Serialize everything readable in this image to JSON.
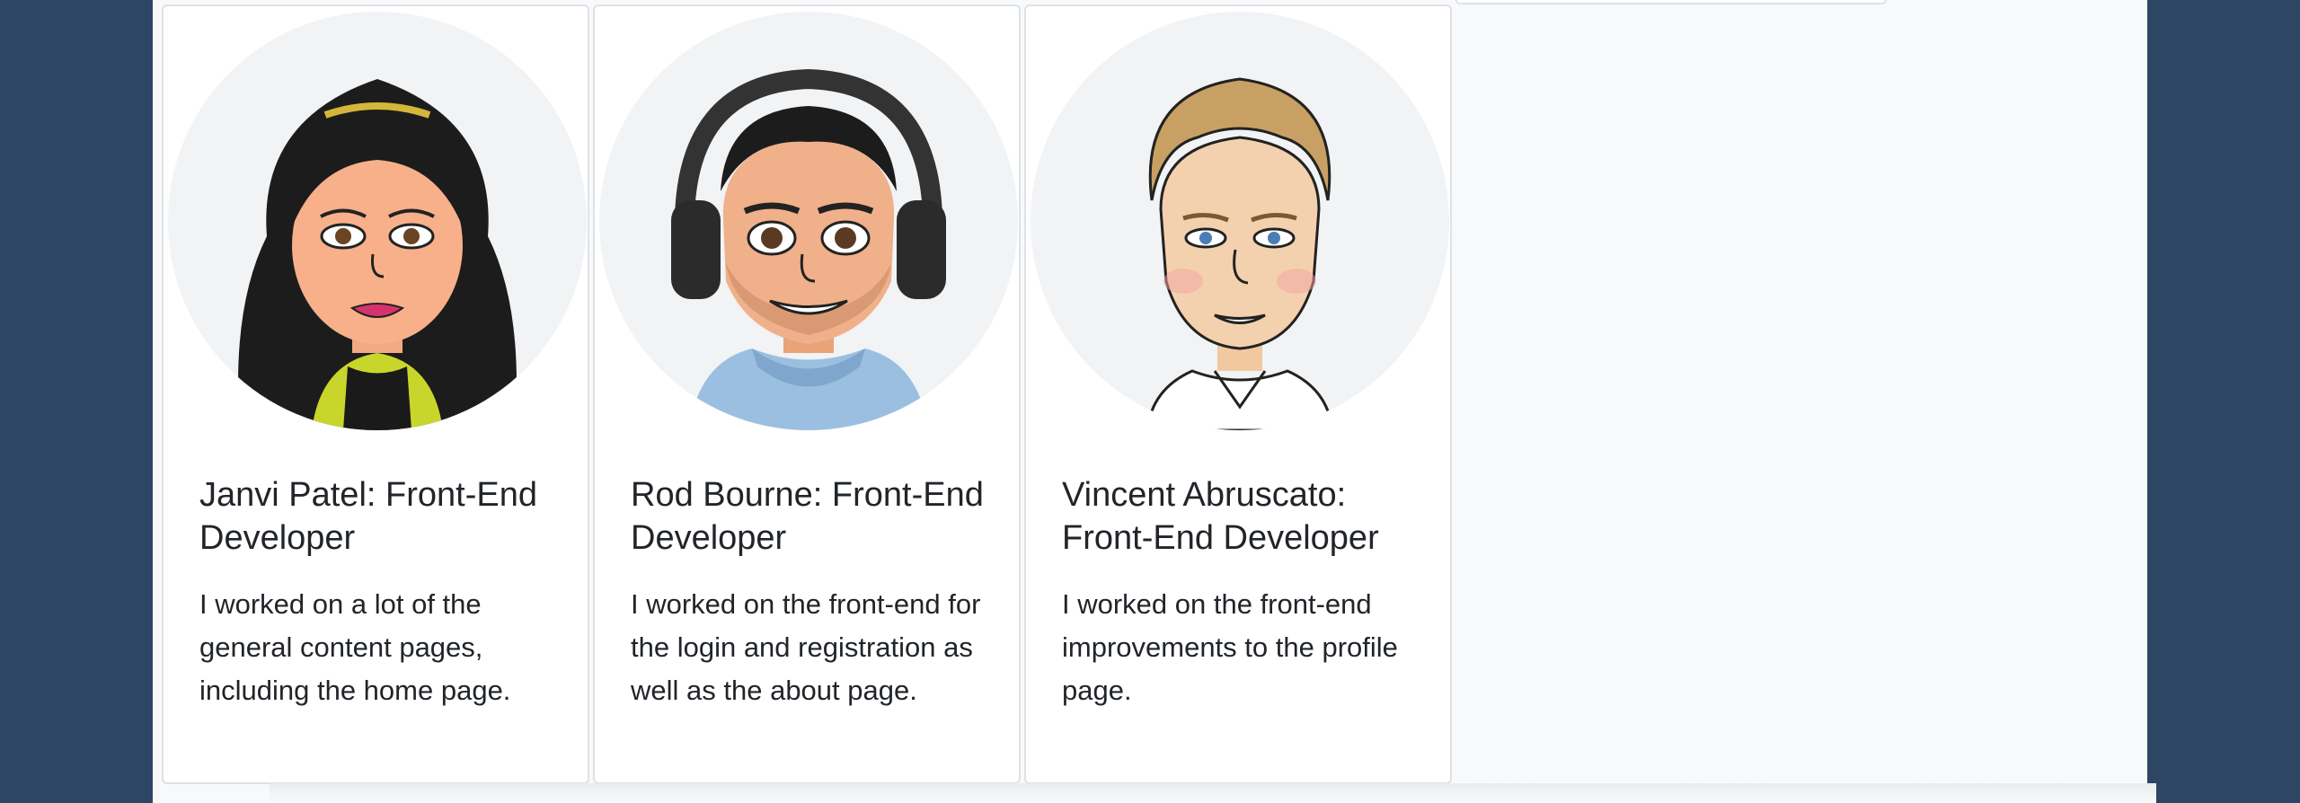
{
  "team": {
    "members": [
      {
        "title": "Janvi Patel: Front-End Developer",
        "description": "I worked on a lot of the general content pages, including the home page.",
        "avatar_icon": "female-developer-avatar"
      },
      {
        "title": "Rod Bourne: Front-End Developer",
        "description": "I worked on the front-end for the login and registration as well as the about page.",
        "avatar_icon": "male-developer-headphones-avatar"
      },
      {
        "title": "Vincent Abruscato: Front-End Developer",
        "description": "I worked on the front-end improvements to the profile page.",
        "avatar_icon": "male-developer-blond-avatar"
      }
    ]
  },
  "colors": {
    "frame": "#2c4664",
    "page_background": "#f8f9fa",
    "card_background": "#ffffff",
    "text": "#212529"
  }
}
